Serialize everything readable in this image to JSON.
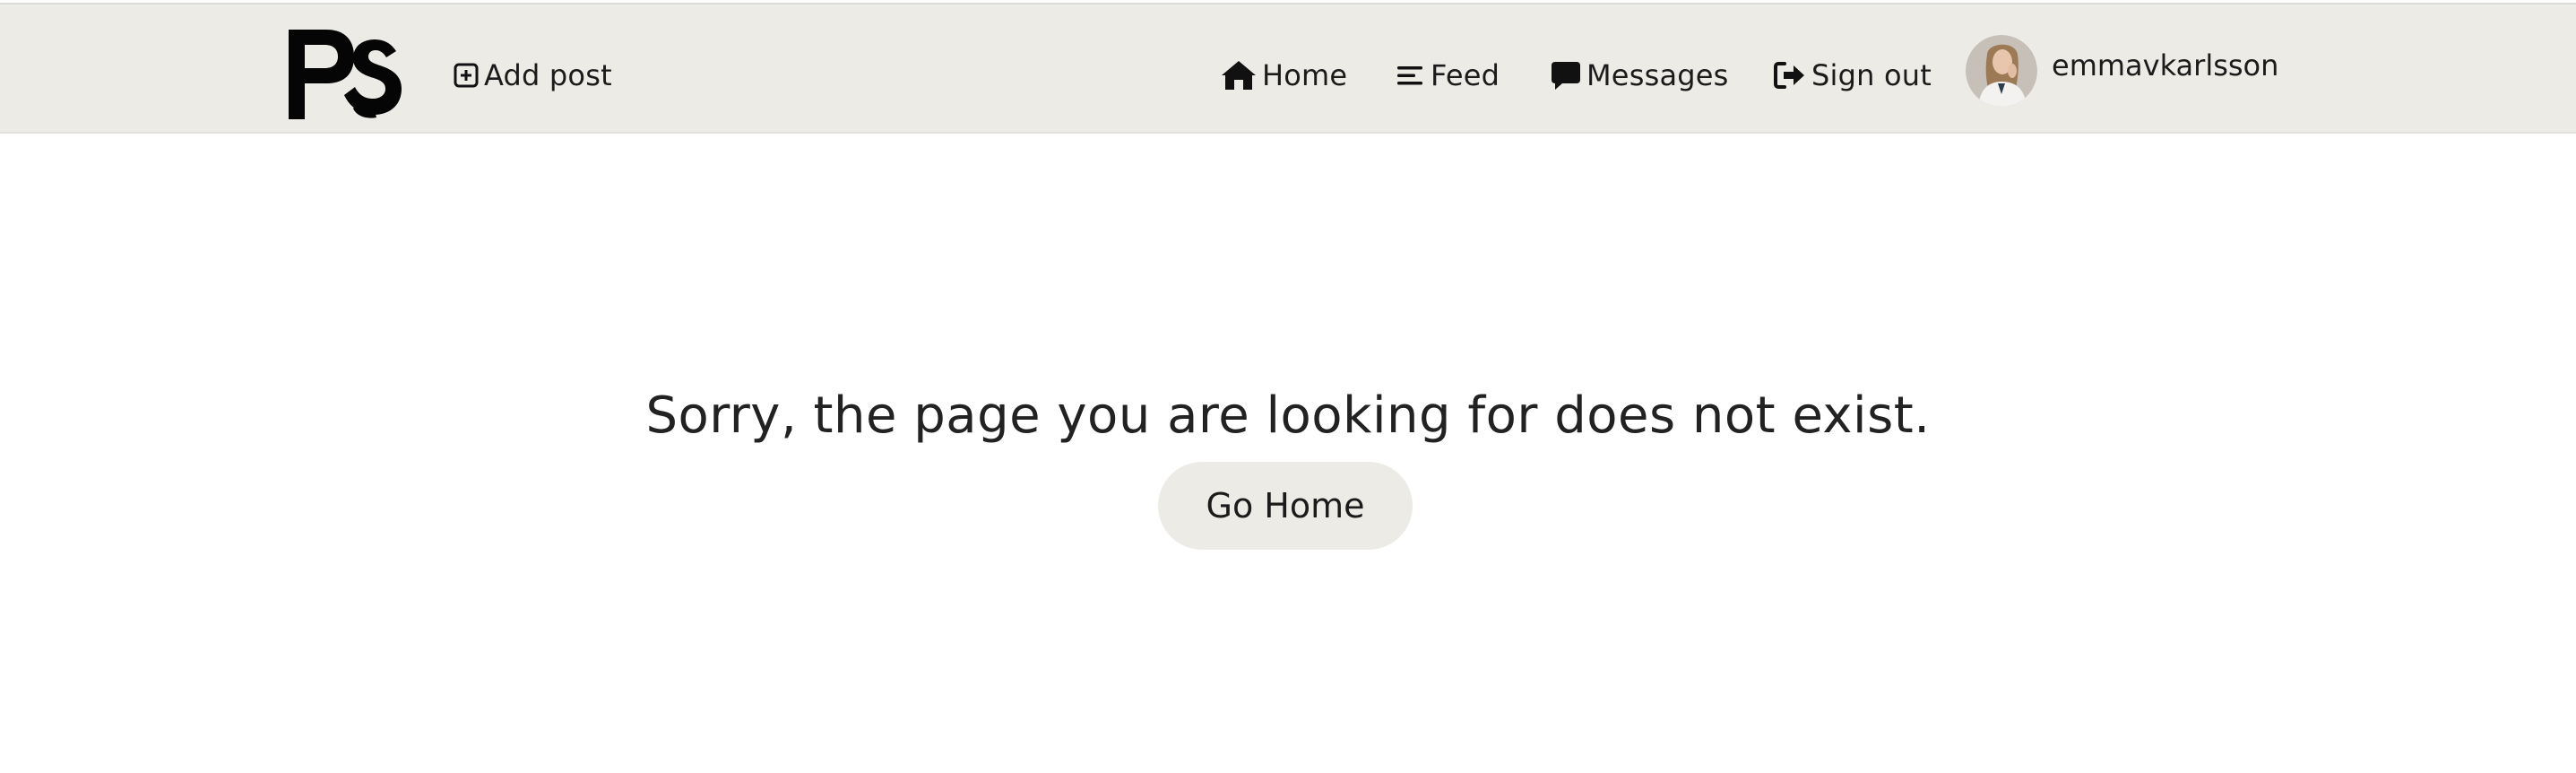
{
  "brand": {
    "logo_text": "PS"
  },
  "nav": {
    "add_post": {
      "label": "Add post",
      "icon": "plus-square-icon"
    },
    "home": {
      "label": "Home",
      "icon": "home-icon"
    },
    "feed": {
      "label": "Feed",
      "icon": "feed-lines-icon"
    },
    "messages": {
      "label": "Messages",
      "icon": "message-bubble-icon"
    },
    "sign_out": {
      "label": "Sign out",
      "icon": "sign-out-icon"
    }
  },
  "profile": {
    "username": "emmavkarlsson",
    "avatar": "avatar-photo"
  },
  "main": {
    "message": "Sorry, the page you are looking for does not exist.",
    "button_label": "Go Home"
  },
  "colors": {
    "navbar_bg": "#edebe6",
    "button_bg": "#edebe6",
    "text": "#1b1b1b",
    "page_bg": "#ffffff"
  }
}
